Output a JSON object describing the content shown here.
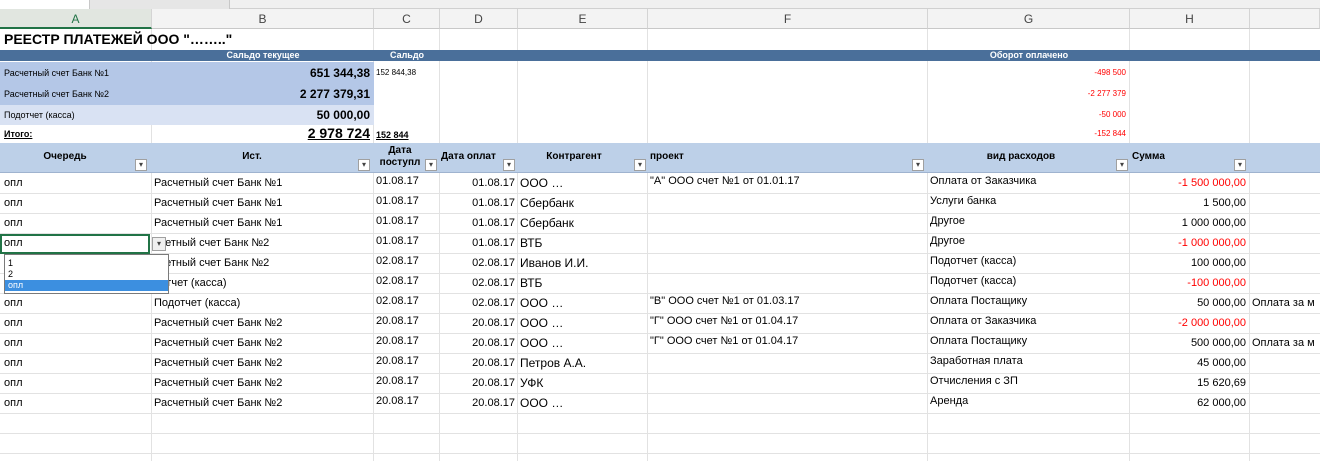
{
  "columns": [
    "A",
    "B",
    "C",
    "D",
    "E",
    "F",
    "G",
    "H"
  ],
  "title": "РЕЕСТР  ПЛАТЕЖЕЙ ООО \"……..\"",
  "band": {
    "saldo_current": "Сальдо текущее",
    "saldo": "Сальдо",
    "turnover": "Оборот оплачено"
  },
  "summary": [
    {
      "label": "Расчетный счет Банк №1",
      "value": "651 344,38",
      "saldo": "152 844,38",
      "turnover": "-498 500"
    },
    {
      "label": "Расчетный счет Банк №2",
      "value": "2 277 379,31",
      "saldo": "",
      "turnover": "-2 277 379"
    },
    {
      "label": "Подотчет (касса)",
      "value": "50 000,00",
      "saldo": "",
      "turnover": "-50 000"
    }
  ],
  "total": {
    "label": "Итого:",
    "value": "2 978 724",
    "saldo": "152 844",
    "turnover": "-152 844"
  },
  "headers": {
    "queue": "Очередь",
    "source": "Ист.",
    "date_in_1": "Дата",
    "date_in_2": "поступл",
    "date_pay": "Дата оплат",
    "counterparty": "Контрагент",
    "project": "проект",
    "expense": "вид расходов",
    "sum": "Сумма"
  },
  "rows": [
    {
      "queue": "опл",
      "source": "Расчетный счет Банк №1",
      "date_in": "01.08.17",
      "date_pay": "01.08.17",
      "cp": "ООО …",
      "project": "\"А\" ООО счет №1 от 01.01.17",
      "expense": "Оплата от Заказчика",
      "sum": "-1 500 000,00",
      "neg": true,
      "extra": ""
    },
    {
      "queue": "опл",
      "source": "Расчетный счет Банк №1",
      "date_in": "01.08.17",
      "date_pay": "01.08.17",
      "cp": "Сбербанк",
      "project": "",
      "expense": "Услуги банка",
      "sum": "1 500,00",
      "neg": false,
      "extra": ""
    },
    {
      "queue": "опл",
      "source": "Расчетный счет Банк №1",
      "date_in": "01.08.17",
      "date_pay": "01.08.17",
      "cp": "Сбербанк",
      "project": "",
      "expense": "Другое",
      "sum": "1 000 000,00",
      "neg": false,
      "extra": ""
    },
    {
      "queue": "опл",
      "source": "счетный счет Банк №2",
      "date_in": "01.08.17",
      "date_pay": "01.08.17",
      "cp": "ВТБ",
      "project": "",
      "expense": "Другое",
      "sum": "-1 000 000,00",
      "neg": true,
      "extra": ""
    },
    {
      "queue": "",
      "source": "счетный счет Банк №2",
      "date_in": "02.08.17",
      "date_pay": "02.08.17",
      "cp": "Иванов И.И.",
      "project": "",
      "expense": "Подотчет (касса)",
      "sum": "100 000,00",
      "neg": false,
      "extra": ""
    },
    {
      "queue": "",
      "source": "дотчет (касса)",
      "date_in": "02.08.17",
      "date_pay": "02.08.17",
      "cp": "ВТБ",
      "project": "",
      "expense": "Подотчет (касса)",
      "sum": "-100 000,00",
      "neg": true,
      "extra": ""
    },
    {
      "queue": "опл",
      "source": "Подотчет (касса)",
      "date_in": "02.08.17",
      "date_pay": "02.08.17",
      "cp": "ООО …",
      "project": "\"В\" ООО счет №1 от 01.03.17",
      "expense": "Оплата Постащику",
      "sum": "50 000,00",
      "neg": false,
      "extra": "Оплата за м"
    },
    {
      "queue": "опл",
      "source": "Расчетный счет Банк №2",
      "date_in": "20.08.17",
      "date_pay": "20.08.17",
      "cp": "ООО …",
      "project": "\"Г\" ООО счет №1 от 01.04.17",
      "expense": "Оплата от Заказчика",
      "sum": "-2 000 000,00",
      "neg": true,
      "extra": ""
    },
    {
      "queue": "опл",
      "source": "Расчетный счет Банк №2",
      "date_in": "20.08.17",
      "date_pay": "20.08.17",
      "cp": "ООО …",
      "project": "\"Г\" ООО счет №1 от 01.04.17",
      "expense": "Оплата Постащику",
      "sum": "500 000,00",
      "neg": false,
      "extra": "Оплата за м"
    },
    {
      "queue": "опл",
      "source": "Расчетный счет Банк №2",
      "date_in": "20.08.17",
      "date_pay": "20.08.17",
      "cp": "Петров А.А.",
      "project": "",
      "expense": "Заработная плата",
      "sum": "45 000,00",
      "neg": false,
      "extra": ""
    },
    {
      "queue": "опл",
      "source": "Расчетный счет Банк №2",
      "date_in": "20.08.17",
      "date_pay": "20.08.17",
      "cp": "УФК",
      "project": "",
      "expense": "Отчисления с ЗП",
      "sum": "15 620,69",
      "neg": false,
      "extra": ""
    },
    {
      "queue": "опл",
      "source": "Расчетный счет Банк №2",
      "date_in": "20.08.17",
      "date_pay": "20.08.17",
      "cp": "ООО …",
      "project": "",
      "expense": "Аренда",
      "sum": "62 000,00",
      "neg": false,
      "extra": ""
    }
  ],
  "dropdown": {
    "options": [
      "1",
      "2",
      "опл"
    ],
    "selected": "опл"
  },
  "colors": {
    "band": "#4a6f9a",
    "summary1": "#b4c7e7",
    "summary2": "#d9e2f3",
    "header": "#bdd0e8",
    "negative": "#ff0000"
  }
}
